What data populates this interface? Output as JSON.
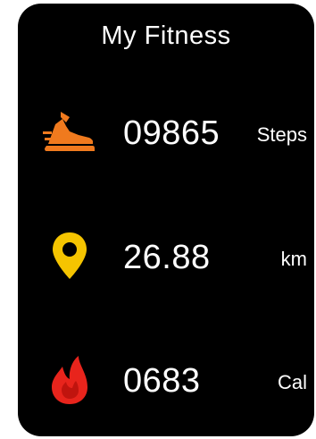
{
  "screen": {
    "title": "My Fitness"
  },
  "metrics": [
    {
      "id": "steps",
      "icon": "running-shoe-icon",
      "icon_color": "#F07A1E",
      "value": "09865",
      "unit": "Steps"
    },
    {
      "id": "distance",
      "icon": "location-pin-icon",
      "icon_color": "#F5C400",
      "value": "26.88",
      "unit": "km"
    },
    {
      "id": "calories",
      "icon": "flame-icon",
      "icon_color": "#E8241C",
      "value": "0683",
      "unit": "Cal"
    }
  ],
  "colors": {
    "background": "#000000",
    "text": "#FFFFFF"
  }
}
